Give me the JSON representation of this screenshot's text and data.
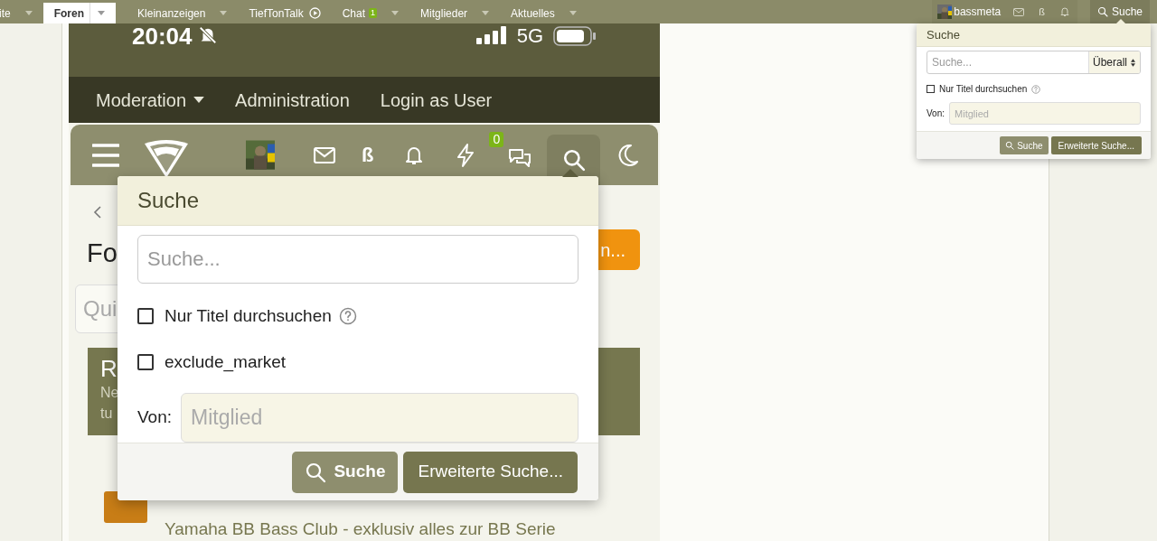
{
  "top_nav": {
    "tabs": [
      {
        "label": "ite",
        "kind": "dropdown",
        "selected": false
      },
      {
        "label": "Foren",
        "kind": "dropdown",
        "selected": true
      },
      {
        "label": "Kleinanzeigen",
        "kind": "dropdown",
        "selected": false
      },
      {
        "label": "TiefTonTalk",
        "kind": "play",
        "selected": false
      },
      {
        "label": "Chat",
        "kind": "dropdown",
        "selected": false,
        "badge": "1"
      },
      {
        "label": "Mitglieder",
        "kind": "dropdown",
        "selected": false
      },
      {
        "label": "Aktuelles",
        "kind": "dropdown",
        "selected": false
      }
    ],
    "user": "bassmeta",
    "beta": "ß",
    "search_label": "Suche",
    "search_selected": true
  },
  "desktop_search": {
    "title": "Suche",
    "placeholder": "Suche...",
    "scope": "Überall",
    "title_only": {
      "label": "Nur Titel durchsuchen",
      "checked": false
    },
    "von_label": "Von:",
    "von_placeholder": "Mitglied",
    "buttons": [
      "Suche",
      "Erweiterte Suche..."
    ]
  },
  "phone": {
    "status": {
      "time": "20:04",
      "network": "5G"
    },
    "mod_bar": [
      {
        "label": "Moderation",
        "kind": "dropdown"
      },
      {
        "label": "Administration",
        "kind": "link"
      },
      {
        "label": "Login as User",
        "kind": "link"
      }
    ],
    "header": {
      "beta": "ß",
      "chat_badge": "0",
      "search_selected": true
    },
    "search_popup": {
      "title": "Suche",
      "placeholder": "Suche...",
      "options": [
        {
          "label": "Nur Titel durchsuchen",
          "checked": false,
          "help": true
        },
        {
          "label": "exclude_market",
          "checked": false,
          "help": false
        }
      ],
      "von_label": "Von:",
      "von_placeholder": "Mitglied",
      "buttons": [
        "Suche",
        "Erweiterte Suche..."
      ]
    },
    "background": {
      "title_fragment": "Fo",
      "button_fragment": "n...",
      "quick_fragment": "Qui",
      "block_fragments": [
        "R",
        "Ne",
        "tu"
      ],
      "forum_title": "Yamaha BB Bass Club - exklusiv alles zur BB Serie"
    }
  }
}
